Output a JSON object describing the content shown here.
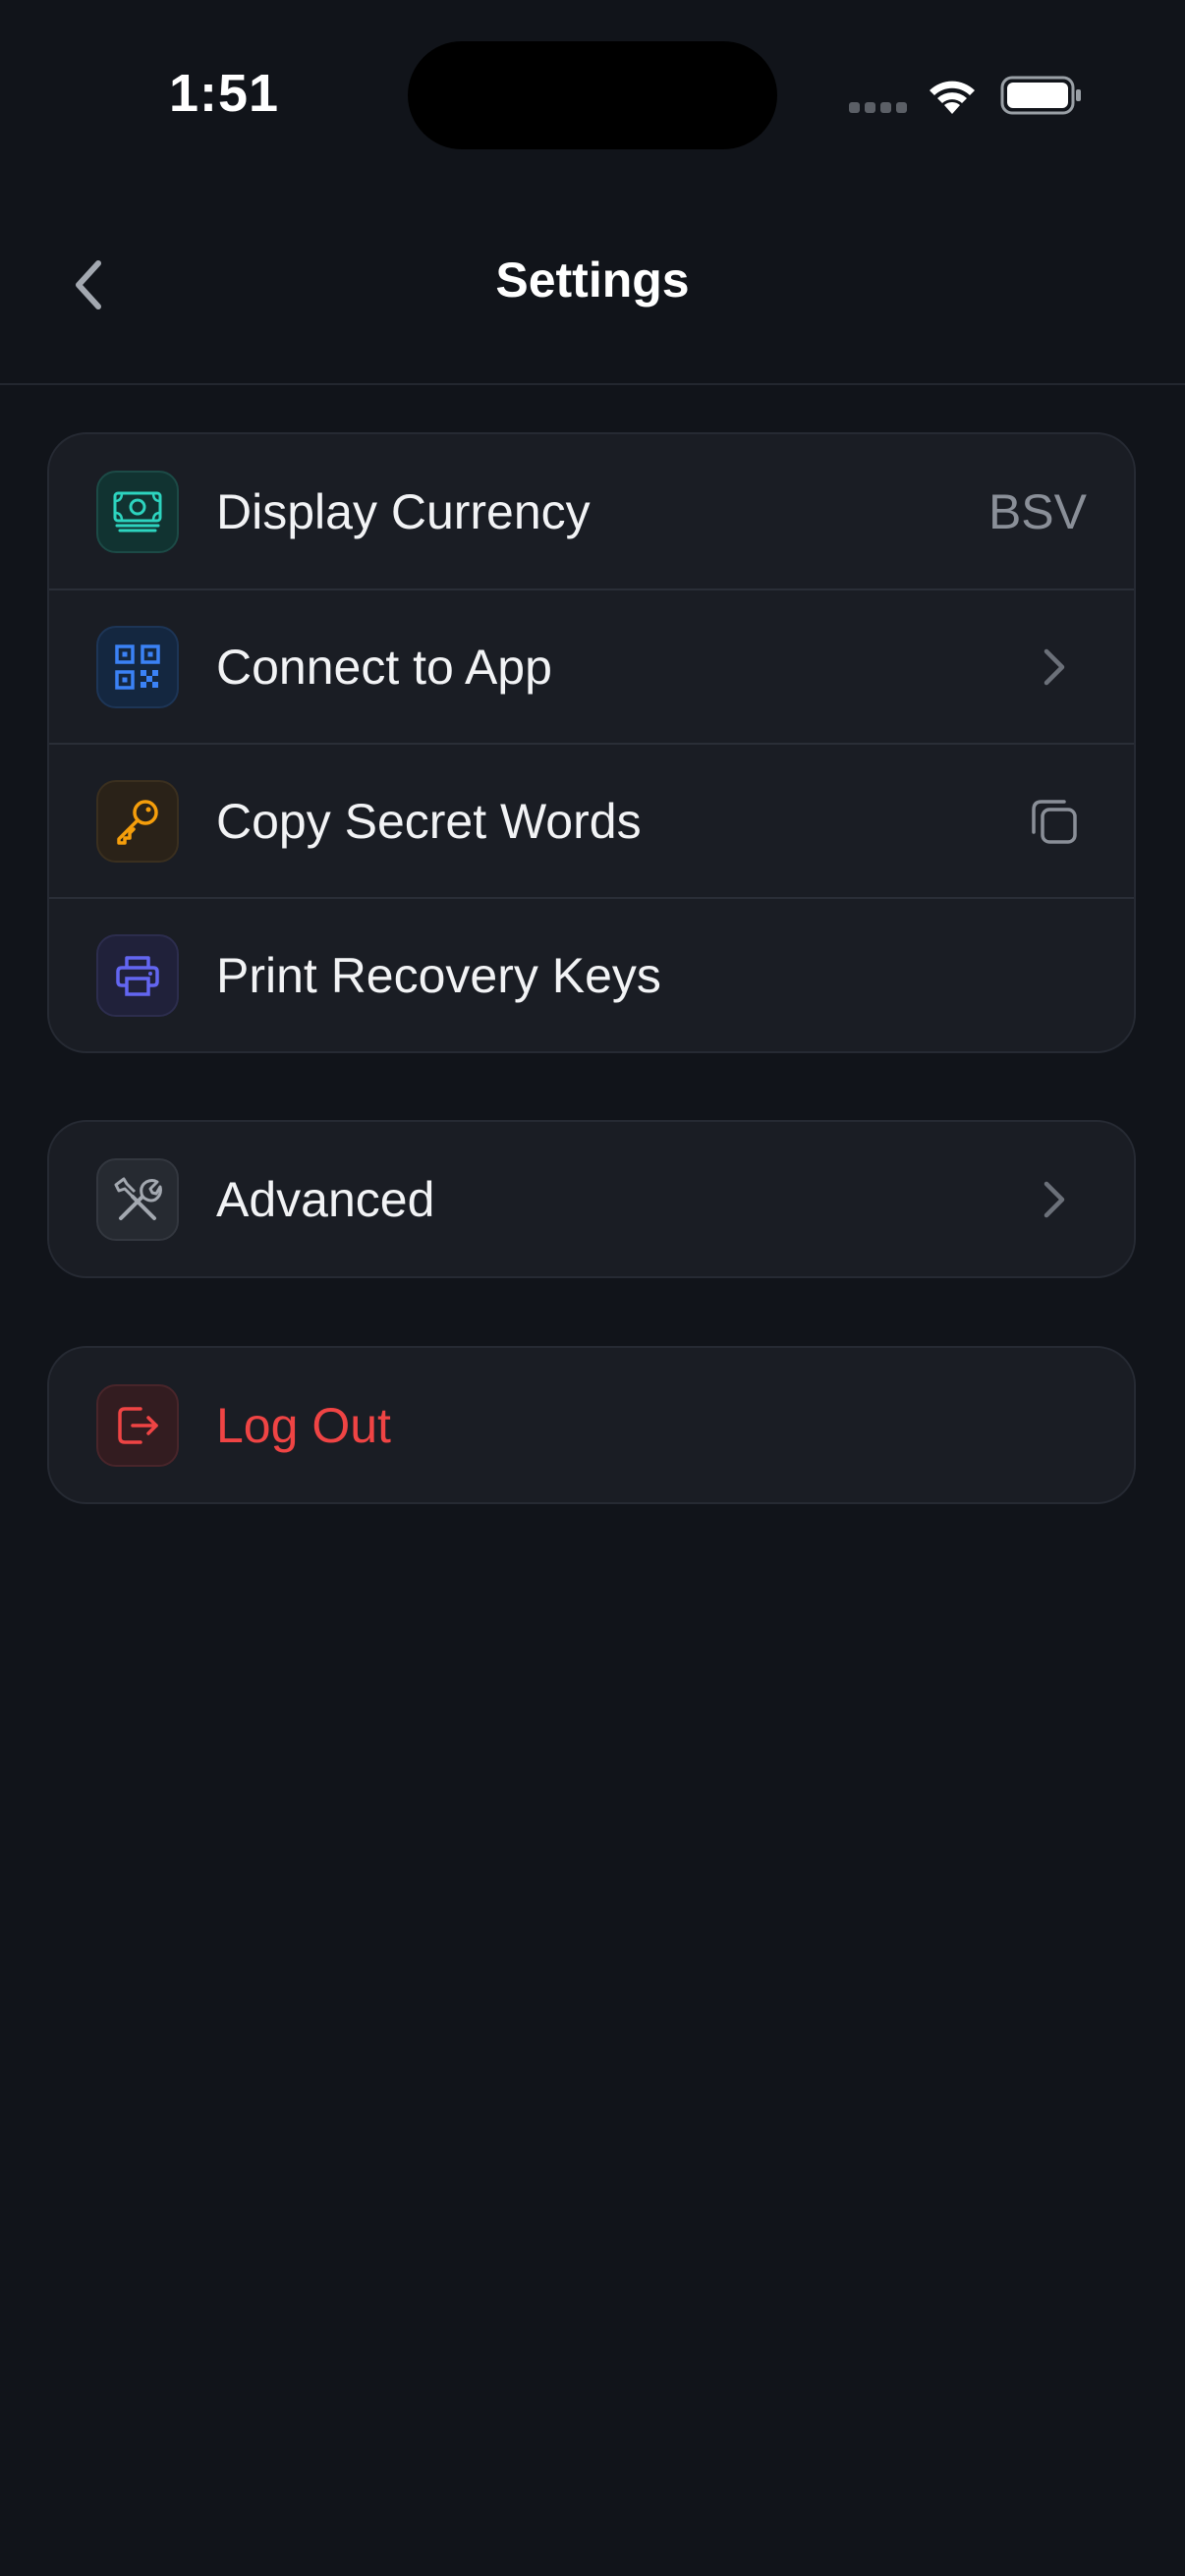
{
  "status_bar": {
    "time": "1:51"
  },
  "nav": {
    "title": "Settings"
  },
  "groups": {
    "main": {
      "items": [
        {
          "label": "Display Currency",
          "value": "BSV",
          "icon": "money-icon",
          "accent": "#2dd4bf"
        },
        {
          "label": "Connect to App",
          "icon": "qr-code-icon",
          "trailing": "chevron-right-icon",
          "accent": "#3b82f6"
        },
        {
          "label": "Copy Secret Words",
          "icon": "key-icon",
          "trailing": "copy-icon",
          "accent": "#f59e0b"
        },
        {
          "label": "Print Recovery Keys",
          "icon": "printer-icon",
          "accent": "#6366f1"
        }
      ]
    },
    "advanced": {
      "label": "Advanced",
      "icon": "tools-icon",
      "trailing": "chevron-right-icon",
      "accent": "#9ca3af"
    },
    "logout": {
      "label": "Log Out",
      "icon": "logout-icon",
      "accent": "#ef4444"
    }
  }
}
